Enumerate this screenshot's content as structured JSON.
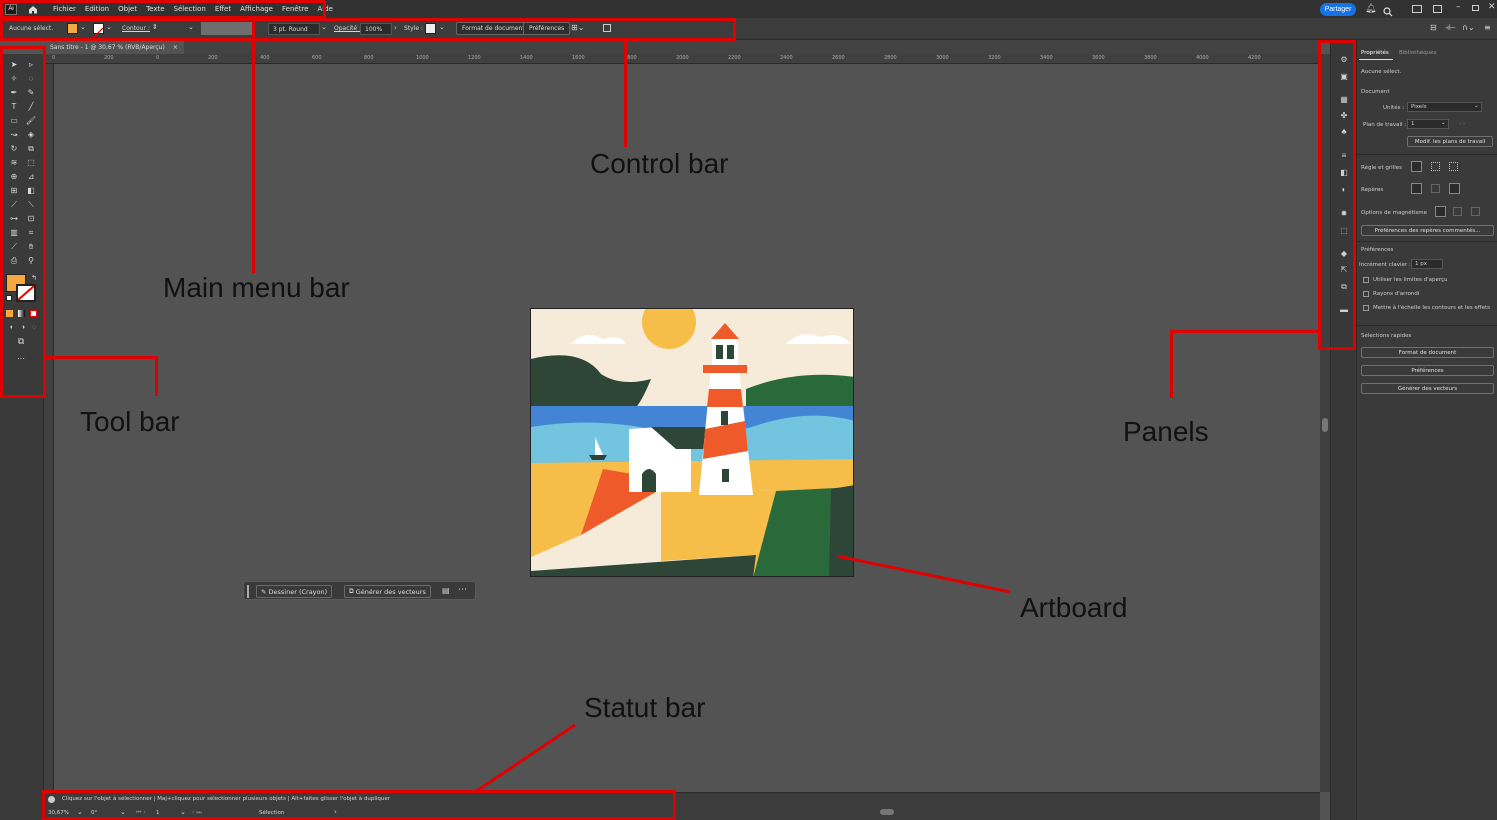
{
  "menubar": {
    "app_badge": "Ai",
    "items": [
      "Fichier",
      "Edition",
      "Objet",
      "Texte",
      "Sélection",
      "Effet",
      "Affichage",
      "Fenêtre",
      "Aide"
    ],
    "share_label": "Partager"
  },
  "controlbar": {
    "selection_label": "Aucune sélect.",
    "stroke_label": "Contour :",
    "brush_label": "3 pt. Round",
    "opacity_label": "Opacité :",
    "opacity_value": "100%",
    "style_label": "Style :",
    "doc_format_button": "Format de document",
    "prefs_button": "Préférences"
  },
  "document_tab": {
    "title": "Sans titre - 1 @ 30,67 % (RVB/Aperçu)",
    "close": "×"
  },
  "ruler_ticks": [
    "0",
    "200",
    "0",
    "200",
    "400",
    "600",
    "800",
    "1000",
    "1200",
    "1400",
    "1600",
    "1800",
    "2000",
    "2200",
    "2400",
    "2600",
    "2800",
    "3000",
    "3200",
    "3400",
    "3600",
    "3800",
    "4000",
    "4200"
  ],
  "context_bar": {
    "draw_button": "Dessiner (Crayon)",
    "generate_button": "Générer des vecteurs",
    "more": "⋯"
  },
  "statusbar": {
    "hint": "Cliquez sur l'objet à sélectionner  |  Maj+cliquez pour sélectionner plusieurs objets  |  Alt+faites glisser l'objet à dupliquer",
    "zoom": "30,67%",
    "rotation": "0°",
    "artboard_num": "1",
    "mode": "Sélection"
  },
  "properties_panel": {
    "tabs": [
      "Propriétés",
      "Bibliothèques"
    ],
    "no_selection": "Aucune sélect.",
    "document_heading": "Document",
    "units_label": "Unités :",
    "units_value": "Pixels",
    "artboard_label": "Plan de travail :",
    "artboard_value": "1",
    "edit_artboards_button": "Modif. les plans de travail",
    "rulers_label": "Règle et grilles",
    "guides_label": "Repères",
    "snap_label": "Options de magnétisme",
    "snap_prefs_button": "Préférences des repères commentés...",
    "preferences_heading": "Préférences",
    "keyboard_increment_label": "Incrément clavier :",
    "keyboard_increment_value": "1 px",
    "checkboxes": [
      "Utiliser les limites d'aperçu",
      "Rayons d'arrondi",
      "Mettre à l'échelle les contours et les effets"
    ],
    "quick_actions_heading": "Sélections rapides",
    "quick_buttons": [
      "Format de document",
      "Préférences",
      "Générer des vecteurs"
    ]
  },
  "annotations": {
    "main_menu_bar": "Main menu bar",
    "control_bar": "Control bar",
    "tool_bar": "Tool bar",
    "panels": "Panels",
    "artboard": "Artboard",
    "statut_bar": "Statut bar"
  },
  "colors": {
    "annotation_red": "#e00000",
    "fill_swatch": "#f5a742",
    "share_blue": "#1473e6"
  }
}
